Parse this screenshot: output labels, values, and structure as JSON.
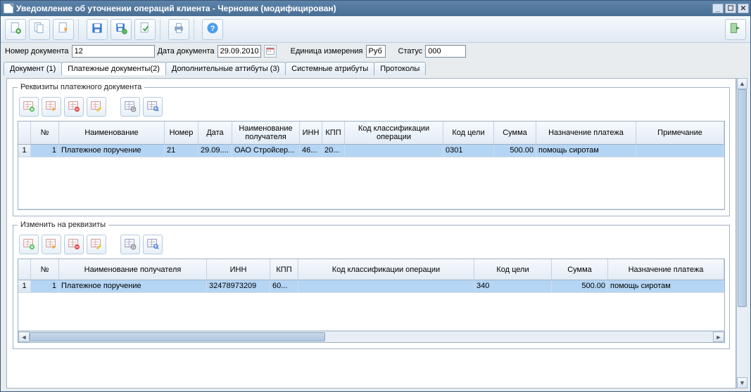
{
  "window": {
    "title": "Уведомление об уточнении операций клиента - Черновик (модифицирован)"
  },
  "form": {
    "doc_number_label": "Номер документа",
    "doc_number_value": "12",
    "doc_date_label": "Дата документа",
    "doc_date_value": "29.09.2010",
    "unit_label": "Единица измерения",
    "unit_value": "Руб",
    "status_label": "Статус",
    "status_value": "000"
  },
  "tabs": {
    "t1": "Документ (1)",
    "t2": "Платежные документы(2)",
    "t3": "Дополнительные аттибуты (3)",
    "t4": "Системные атрибуты",
    "t5": "Протоколы"
  },
  "group1": {
    "legend": "Реквизиты платежного документа",
    "headers": {
      "num": "№",
      "name": "Наименование",
      "number": "Номер",
      "date": "Дата",
      "recipient": "Наименование получателя",
      "inn": "ИНН",
      "kpp": "КПП",
      "opclass": "Код классификации операции",
      "goal": "Код цели",
      "sum": "Сумма",
      "purpose": "Назначение платежа",
      "note": "Примечание"
    },
    "rows": [
      {
        "idx": "1",
        "num": "1",
        "name": "Платежное поручение",
        "number": "21",
        "date": "29.09....",
        "recipient": "ОАО Стройсер...",
        "inn": "46...",
        "kpp": "20...",
        "opclass": "",
        "goal": "0301",
        "sum": "500.00",
        "purpose": "помощь сиротам",
        "note": ""
      }
    ]
  },
  "group2": {
    "legend": "Изменить на реквизиты",
    "headers": {
      "num": "№",
      "recipient": "Наименование получателя",
      "inn": "ИНН",
      "kpp": "КПП",
      "opclass": "Код классификации операции",
      "goal": "Код цели",
      "sum": "Сумма",
      "purpose": "Назначение платежа"
    },
    "rows": [
      {
        "idx": "1",
        "num": "1",
        "recipient": "Платежное поручение",
        "inn": "32478973209",
        "kpp": "60...",
        "opclass": "",
        "goal": "340",
        "sum": "500.00",
        "purpose": "помощь сиротам"
      }
    ]
  }
}
